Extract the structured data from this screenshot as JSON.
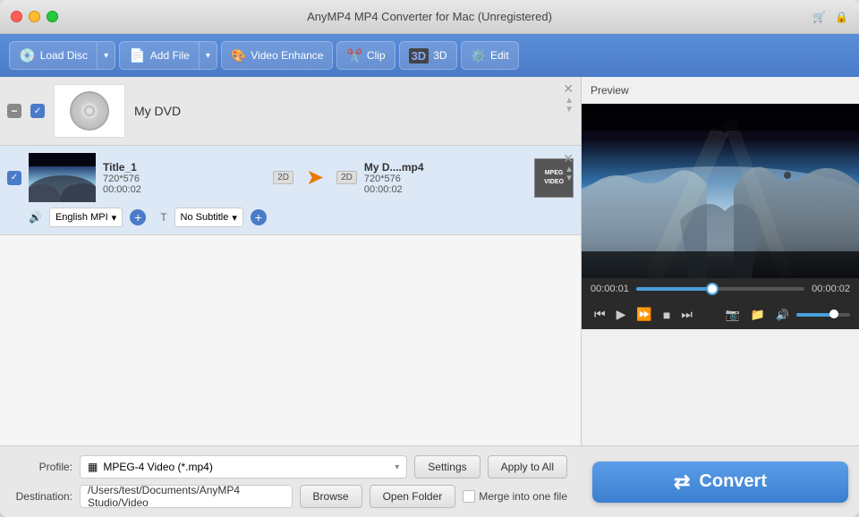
{
  "window": {
    "title": "AnyMP4 MP4 Converter for Mac (Unregistered)"
  },
  "toolbar": {
    "load_disc": "Load Disc",
    "add_file": "Add File",
    "video_enhance": "Video Enhance",
    "clip": "Clip",
    "three_d": "3D",
    "edit": "Edit"
  },
  "dvd_item": {
    "label": "My DVD"
  },
  "video_item": {
    "title": "Title_1",
    "resolution": "720*576",
    "duration": "00:00:02",
    "badge_2d": "2D",
    "output_name": "My D....mp4",
    "output_resolution": "720*576",
    "output_duration": "00:00:02",
    "codec": "MPEG\nVIDEO",
    "audio_label": "English MPI",
    "subtitle_label": "No Subtitle"
  },
  "preview": {
    "header": "Preview",
    "time_current": "00:00:01",
    "time_total": "00:00:02"
  },
  "bottom": {
    "profile_label": "Profile:",
    "profile_value": "MPEG-4 Video (*.mp4)",
    "settings_btn": "Settings",
    "apply_to_all_btn": "Apply to All",
    "destination_label": "Destination:",
    "destination_path": "/Users/test/Documents/AnyMP4 Studio/Video",
    "browse_btn": "Browse",
    "open_folder_btn": "Open Folder",
    "merge_label": "Merge into one file",
    "convert_btn": "Convert"
  },
  "icons": {
    "close": "✕",
    "minimize": "−",
    "arrow_down": "▾",
    "arrow_right": "▸",
    "arrow_up": "▴",
    "check": "✓",
    "cart": "🛒",
    "person": "👤",
    "scissors": "✂",
    "play": "▶",
    "fast_forward": "⏩",
    "stop": "■",
    "skip_end": "⏭",
    "rewind_start": "⏮",
    "camera": "📷",
    "folder": "📁",
    "volume": "🔊",
    "speaker": "◀",
    "arrow_orange": "➤",
    "refresh": "⇄",
    "grid": "▦"
  }
}
